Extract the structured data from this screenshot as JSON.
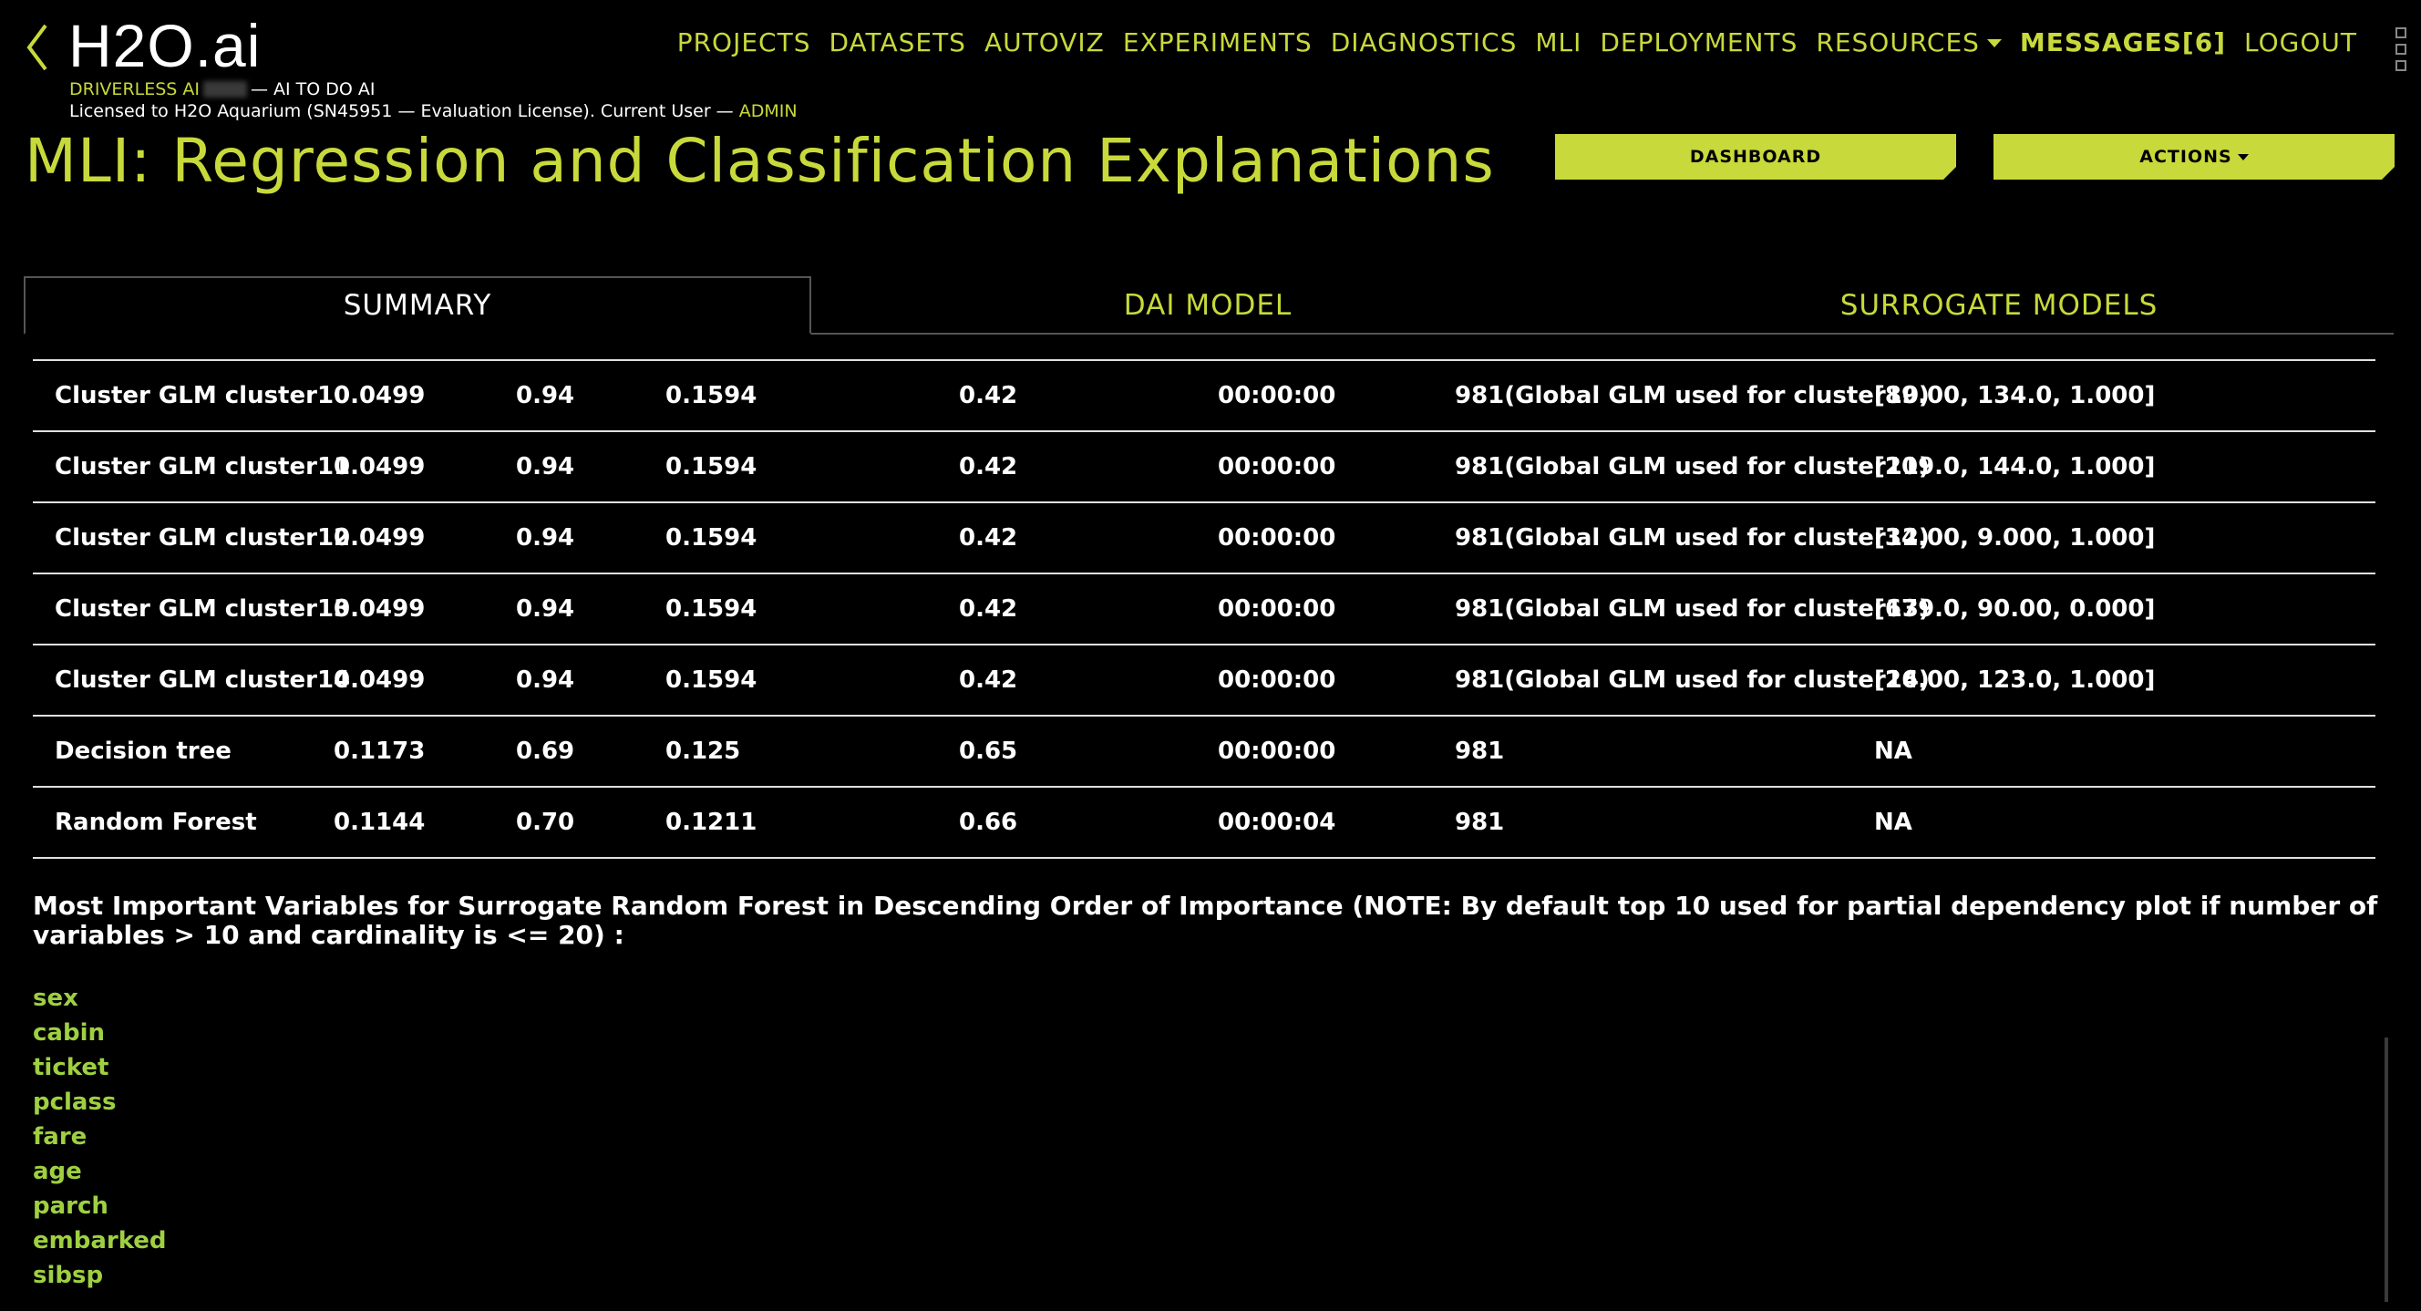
{
  "header": {
    "logo": "H2O.ai",
    "product": "DRIVERLESS AI",
    "tagline": "— AI TO DO AI",
    "license_prefix": "Licensed to H2O Aquarium (SN45951 — Evaluation License). Current User —",
    "current_user": "ADMIN"
  },
  "nav": [
    {
      "label": "PROJECTS"
    },
    {
      "label": "DATASETS"
    },
    {
      "label": "AUTOVIZ"
    },
    {
      "label": "EXPERIMENTS"
    },
    {
      "label": "DIAGNOSTICS"
    },
    {
      "label": "MLI"
    },
    {
      "label": "DEPLOYMENTS"
    },
    {
      "label": "RESOURCES"
    },
    {
      "label": "MESSAGES[6]"
    },
    {
      "label": "LOGOUT"
    }
  ],
  "page": {
    "title": "MLI: Regression and Classification Explanations",
    "dashboard_label": "DASHBOARD",
    "actions_label": "ACTIONS"
  },
  "tabs": [
    {
      "label": "SUMMARY"
    },
    {
      "label": "DAI MODEL"
    },
    {
      "label": "SURROGATE MODELS"
    }
  ],
  "table": {
    "rows": [
      [
        "Cluster GLM cluster10",
        "0.0499",
        "0.94",
        "0.1594",
        "0.42",
        "00:00:00",
        "981(Global GLM used for cluster10)",
        "[89.00, 134.0, 1.000]"
      ],
      [
        "Cluster GLM cluster11",
        "0.0499",
        "0.94",
        "0.1594",
        "0.42",
        "00:00:00",
        "981(Global GLM used for cluster11)",
        "[209.0, 144.0, 1.000]"
      ],
      [
        "Cluster GLM cluster12",
        "0.0499",
        "0.94",
        "0.1594",
        "0.42",
        "00:00:00",
        "981(Global GLM used for cluster12)",
        "[34.00, 9.000, 1.000]"
      ],
      [
        "Cluster GLM cluster13",
        "0.0499",
        "0.94",
        "0.1594",
        "0.42",
        "00:00:00",
        "981(Global GLM used for cluster13)",
        "[679.0, 90.00, 0.000]"
      ],
      [
        "Cluster GLM cluster14",
        "0.0499",
        "0.94",
        "0.1594",
        "0.42",
        "00:00:00",
        "981(Global GLM used for cluster14)",
        "[26.00, 123.0, 1.000]"
      ],
      [
        "Decision tree",
        "0.1173",
        "0.69",
        "0.125",
        "0.65",
        "00:00:00",
        "981",
        "NA"
      ],
      [
        "Random Forest",
        "0.1144",
        "0.70",
        "0.1211",
        "0.66",
        "00:00:04",
        "981",
        "NA"
      ]
    ]
  },
  "variables": {
    "heading": "Most Important Variables for Surrogate Random Forest in Descending Order of Importance (NOTE: By default top 10 used for partial dependency plot if number of variables > 10 and cardinality is <= 20) :",
    "items": [
      "sex",
      "cabin",
      "ticket",
      "pclass",
      "fare",
      "age",
      "parch",
      "embarked",
      "sibsp"
    ]
  },
  "colors": {
    "accent": "#c8d93b",
    "variable_link": "#9ed041",
    "background": "#000000"
  },
  "icons": {
    "back": "chevron-left-icon",
    "menu": "more-vertical-icon"
  }
}
